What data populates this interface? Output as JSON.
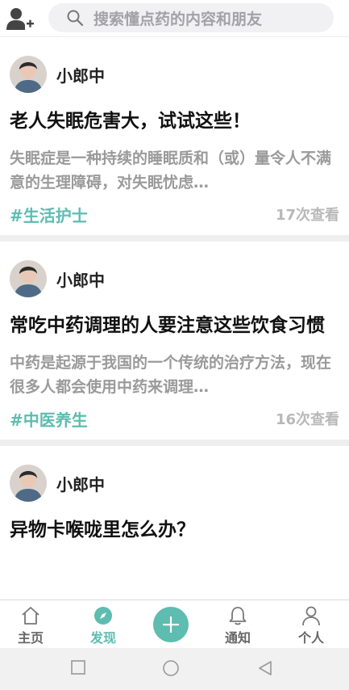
{
  "search": {
    "placeholder": "搜索懂点药的内容和朋友"
  },
  "feed": [
    {
      "author": "小郎中",
      "title": "老人失眠危害大，试试这些！",
      "excerpt": "失眠症是一种持续的睡眠质和（或）量令人不满意的生理障碍，对失眠忧虑…",
      "tag": "#生活护士",
      "views": "17次查看"
    },
    {
      "author": "小郎中",
      "title": "常吃中药调理的人要注意这些饮食习惯",
      "excerpt": "中药是起源于我国的一个传统的治疗方法，现在很多人都会使用中药来调理…",
      "tag": "#中医养生",
      "views": "16次查看"
    },
    {
      "author": "小郎中",
      "title": "异物卡喉咙里怎么办？"
    }
  ],
  "tabs": [
    {
      "label": "主页",
      "icon": "home-icon"
    },
    {
      "label": "发现",
      "icon": "compass-icon"
    },
    {
      "label": "",
      "icon": "plus-icon"
    },
    {
      "label": "通知",
      "icon": "bell-icon"
    },
    {
      "label": "个人",
      "icon": "person-icon"
    }
  ],
  "colors": {
    "accent": "#5ebcb0",
    "muted": "#9a9a9a",
    "separator": "#efefef"
  }
}
